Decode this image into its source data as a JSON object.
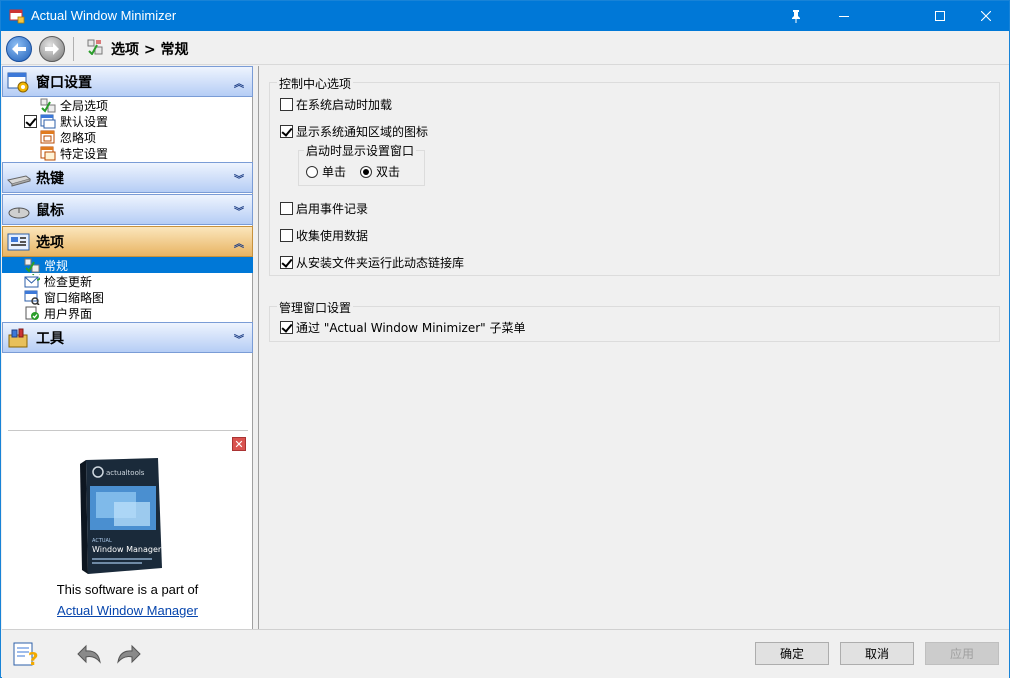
{
  "window": {
    "title": "Actual Window Minimizer",
    "controls": {
      "pin": "pin-icon",
      "minimize": "–",
      "maximize": "□",
      "close": "✕"
    }
  },
  "toolbar": {
    "breadcrumb": "选项 > 常规",
    "back_icon": "back-arrow-icon",
    "forward_icon": "forward-arrow-icon"
  },
  "sidebar": {
    "sections": [
      {
        "label": "窗口设置",
        "expanded": true,
        "items": [
          {
            "label": "全局选项",
            "checkbox": false
          },
          {
            "label": "默认设置",
            "checkbox": true,
            "checked": true
          },
          {
            "label": "忽略项",
            "checkbox": false
          },
          {
            "label": "特定设置",
            "checkbox": false
          }
        ]
      },
      {
        "label": "热键",
        "expanded": false
      },
      {
        "label": "鼠标",
        "expanded": false
      },
      {
        "label": "选项",
        "expanded": true,
        "active": true,
        "items": [
          {
            "label": "常规",
            "selected": true
          },
          {
            "label": "检查更新"
          },
          {
            "label": "窗口缩略图"
          },
          {
            "label": "用户界面"
          }
        ]
      },
      {
        "label": "工具",
        "expanded": false
      }
    ],
    "ad": {
      "text": "This software is a part of",
      "link": "Actual Window Manager",
      "box_brand": "actualtools",
      "box_small": "ACTUAL",
      "box_title": "Window Manager"
    }
  },
  "main": {
    "group1": {
      "title": "控制中心选项",
      "options": [
        {
          "label": "在系统启动时加载",
          "checked": false
        },
        {
          "label": "显示系统通知区域的图标",
          "checked": true
        }
      ],
      "subgroup": {
        "title": "启动时显示设置窗口",
        "radios": [
          {
            "label": "单击",
            "selected": false
          },
          {
            "label": "双击",
            "selected": true
          }
        ]
      },
      "options2": [
        {
          "label": "启用事件记录",
          "checked": false
        },
        {
          "label": "收集使用数据",
          "checked": false
        },
        {
          "label": "从安装文件夹运行此动态链接库",
          "checked": true
        }
      ]
    },
    "group2": {
      "title": "管理窗口设置",
      "options": [
        {
          "label": "通过 \"Actual Window Minimizer\" 子菜单",
          "checked": true
        }
      ]
    }
  },
  "bottom": {
    "ok": "确定",
    "cancel": "取消",
    "apply": "应用",
    "apply_enabled": false
  },
  "colors": {
    "titlebar": "#0078d7",
    "section_header": "#b5cdf5",
    "section_active": "#e8b463",
    "selection": "#0078d7"
  }
}
